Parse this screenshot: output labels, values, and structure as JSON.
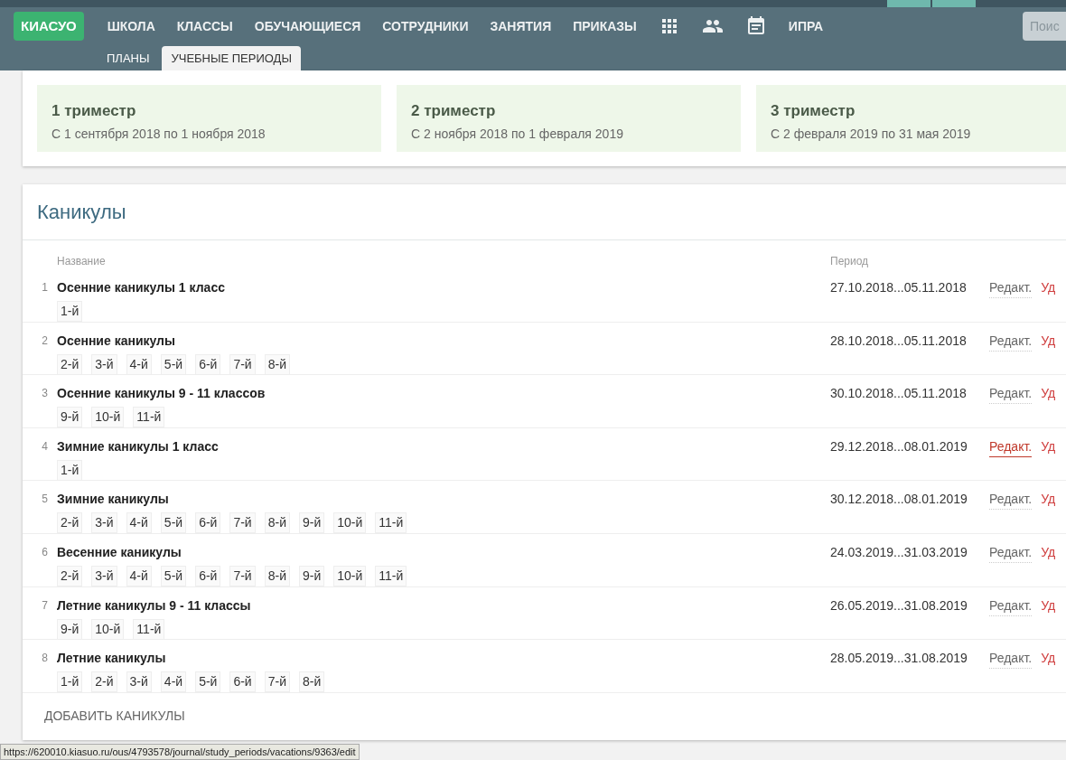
{
  "header": {
    "logo": "КИАСУО",
    "nav": [
      {
        "kind": "text",
        "label": "ШКОЛА"
      },
      {
        "kind": "text",
        "label": "КЛАССЫ"
      },
      {
        "kind": "text",
        "label": "ОБУЧАЮЩИЕСЯ"
      },
      {
        "kind": "text",
        "label": "СОТРУДНИКИ"
      },
      {
        "kind": "text",
        "label": "ЗАНЯТИЯ"
      },
      {
        "kind": "text",
        "label": "ПРИКАЗЫ"
      },
      {
        "kind": "grid"
      },
      {
        "kind": "people"
      },
      {
        "kind": "calendar"
      },
      {
        "kind": "text",
        "label": "ИПРА"
      }
    ],
    "search": {
      "placeholder": "Поис"
    },
    "subtabs": [
      {
        "label": "ПЛАНЫ",
        "selected": false
      },
      {
        "label": "УЧЕБНЫЕ ПЕРИОДЫ",
        "selected": true
      }
    ]
  },
  "periods": [
    {
      "title": "1 триместр",
      "dates": "С 1 сентября 2018 по 1 ноября 2018"
    },
    {
      "title": "2 триместр",
      "dates": "С 2 ноября 2018 по 1 февраля 2019"
    },
    {
      "title": "3 триместр",
      "dates": "С 2 февраля 2019 по 31 мая 2019"
    }
  ],
  "vacations": {
    "title": "Каникулы",
    "columns": [
      "Название",
      "Период"
    ],
    "rows": [
      {
        "number": "1",
        "name": "Осенние каникулы 1 класс",
        "grades": [
          "1-й"
        ],
        "period": "27.10.2018...05.11.2018",
        "edit": "Редакт.",
        "edit_highlighted": false,
        "delete": "Уд"
      },
      {
        "number": "2",
        "name": "Осенние каникулы",
        "grades": [
          "2-й",
          "3-й",
          "4-й",
          "5-й",
          "6-й",
          "7-й",
          "8-й"
        ],
        "period": "28.10.2018...05.11.2018",
        "edit": "Редакт.",
        "edit_highlighted": false,
        "delete": "Уд"
      },
      {
        "number": "3",
        "name": "Осенние каникулы 9 - 11 классов",
        "grades": [
          "9-й",
          "10-й",
          "11-й"
        ],
        "period": "30.10.2018...05.11.2018",
        "edit": "Редакт.",
        "edit_highlighted": false,
        "delete": "Уд"
      },
      {
        "number": "4",
        "name": "Зимние каникулы 1 класс",
        "grades": [
          "1-й"
        ],
        "period": "29.12.2018...08.01.2019",
        "edit": "Редакт.",
        "edit_highlighted": true,
        "delete": "Уд"
      },
      {
        "number": "5",
        "name": "Зимние каникулы",
        "grades": [
          "2-й",
          "3-й",
          "4-й",
          "5-й",
          "6-й",
          "7-й",
          "8-й",
          "9-й",
          "10-й",
          "11-й"
        ],
        "period": "30.12.2018...08.01.2019",
        "edit": "Редакт.",
        "edit_highlighted": false,
        "delete": "Уд"
      },
      {
        "number": "6",
        "name": "Весенние каникулы",
        "grades": [
          "2-й",
          "3-й",
          "4-й",
          "5-й",
          "6-й",
          "7-й",
          "8-й",
          "9-й",
          "10-й",
          "11-й"
        ],
        "period": "24.03.2019...31.03.2019",
        "edit": "Редакт.",
        "edit_highlighted": false,
        "delete": "Уд"
      },
      {
        "number": "7",
        "name": "Летние каникулы 9 - 11 классы",
        "grades": [
          "9-й",
          "10-й",
          "11-й"
        ],
        "period": "26.05.2019...31.08.2019",
        "edit": "Редакт.",
        "edit_highlighted": false,
        "delete": "Уд"
      },
      {
        "number": "8",
        "name": "Летние каникулы",
        "grades": [
          "1-й",
          "2-й",
          "3-й",
          "4-й",
          "5-й",
          "6-й",
          "7-й",
          "8-й"
        ],
        "period": "28.05.2019...31.08.2019",
        "edit": "Редакт.",
        "edit_highlighted": false,
        "delete": "Уд"
      }
    ],
    "add_button": "ДОБАВИТЬ КАНИКУЛЫ"
  },
  "status_url": "https://620010.kiasuo.ru/ous/4793578/journal/study_periods/vacations/9363/edit"
}
